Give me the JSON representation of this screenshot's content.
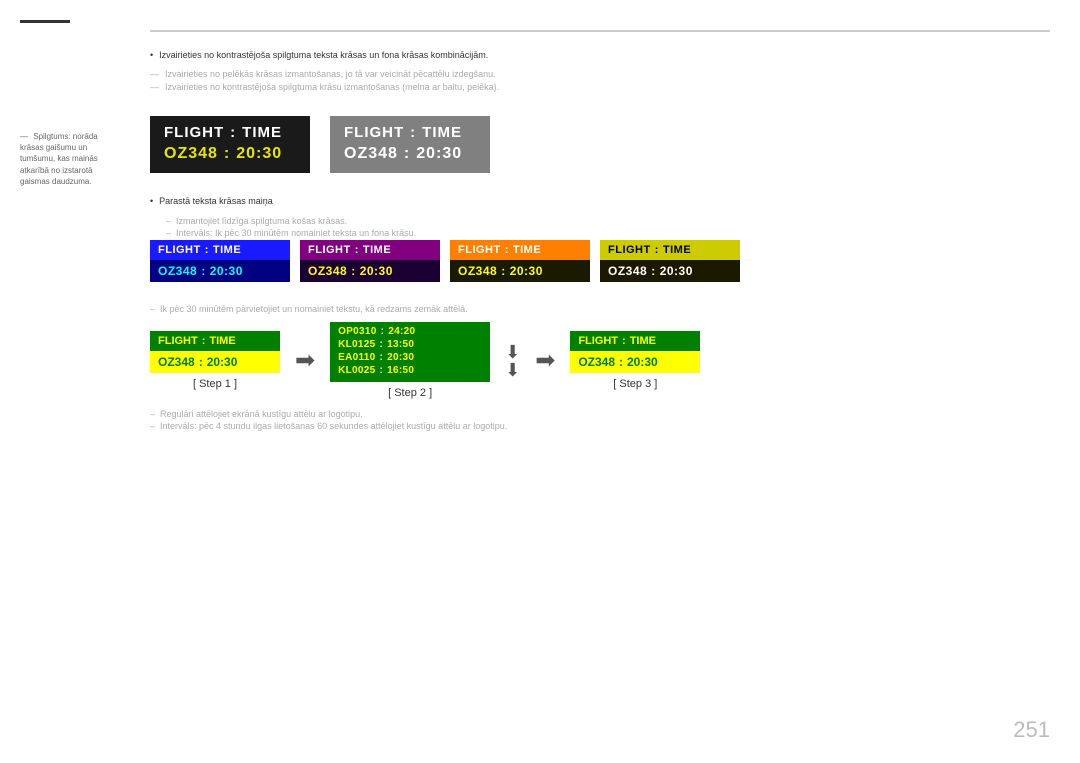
{
  "page": {
    "number": "251"
  },
  "sidebar": {
    "text": "Spilgtums: norāda krāsas gaišumu un tumšumu, kas mainās atkarībā no izstarotā gaismas daudzuma."
  },
  "bullets": {
    "main": [
      "Izvairieties no kontrastējoša spilgtuma teksta krāsas un fona krāsas kombinācijām."
    ],
    "strikethrough": [
      "Izvairieties no pelēkās krāsas izmantošanas, jo tā var veicināt pēcattēlu izdegšanu.",
      "Izvairieties no kontrastējoša spilgtuma krāsu izmantošanas (melna ar baltu, pelēka)."
    ]
  },
  "board1": {
    "label1": "FLIGHT",
    "colon1": ":",
    "label2": "TIME",
    "code": "OZ348",
    "colon2": ":",
    "time": "20:30"
  },
  "board2": {
    "label1": "FLIGHT",
    "colon1": ":",
    "label2": "TIME",
    "code": "OZ348",
    "colon2": ":",
    "time": "20:30"
  },
  "sub_section": {
    "bullet": "Parastā teksta krāsas maiņa",
    "dash1": "Izmantojiet līdzīga spilgtuma košas krāsas.",
    "dash2": "Intervāls: Ik pēc 30 minūtēm nomainiet teksta un fona krāsu."
  },
  "colored_boards": [
    {
      "id": "blue",
      "top_label1": "FLIGHT",
      "top_colon": ":",
      "top_label2": "TIME",
      "bot_code": "OZ348",
      "bot_colon": ":",
      "bot_time": "20:30"
    },
    {
      "id": "purple",
      "top_label1": "FLIGHT",
      "top_colon": ":",
      "top_label2": "TIME",
      "bot_code": "OZ348",
      "bot_colon": ":",
      "bot_time": "20:30"
    },
    {
      "id": "orange",
      "top_label1": "FLIGHT",
      "top_colon": ":",
      "top_label2": "TIME",
      "bot_code": "OZ348",
      "bot_colon": ":",
      "bot_time": "20:30"
    },
    {
      "id": "yellow",
      "top_label1": "FLIGHT",
      "top_colon": ":",
      "top_label2": "TIME",
      "bot_code": "OZ348",
      "bot_colon": ":",
      "bot_time": "20:30"
    }
  ],
  "step_section": {
    "dash": "Ik pēc 30 minūtēm pārvietojiet un nomainiet tekstu, kā redzams zemāk attēlā.",
    "step1": {
      "label": "[ Step 1 ]",
      "top1": "FLIGHT",
      "top2": "TIME",
      "code": "OZ348",
      "time": "20:30"
    },
    "step2": {
      "label": "[ Step 2 ]",
      "flights": [
        {
          "code": "OP0310",
          "time": "24:20"
        },
        {
          "code": "KL0125",
          "time": "13:50"
        },
        {
          "code": "EA0110",
          "time": "20:30"
        },
        {
          "code": "KL0025",
          "time": "16:50"
        }
      ]
    },
    "step3": {
      "label": "[ Step 3 ]",
      "top1": "FLIGHT",
      "top2": "TIME",
      "code": "OZ348",
      "time": "20:30"
    }
  },
  "screensaver_section": {
    "dash1": "Regulāri attēlojiet ekrānā kustīgu attēlu ar logotipu.",
    "dash2": "Intervāls: pēc 4 stundu ilgas lietošanas 60 sekundes attēlojiet kustīgu attēlu ar logotipu."
  }
}
